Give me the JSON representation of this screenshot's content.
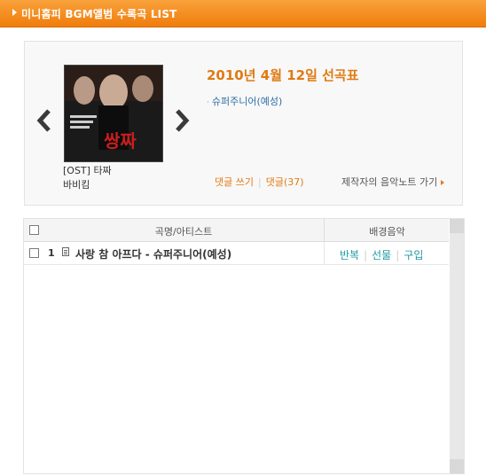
{
  "header": {
    "title": "미니홈피 BGM앨범 수록곡 LIST"
  },
  "featured": {
    "date": "2010년 4월 12일 선곡표",
    "song": "슈퍼주니어(예성)",
    "album": "[OST] 타짜",
    "artist": "바비킴",
    "cover_caption": "쌍짜"
  },
  "links": {
    "write_comment": "댓글 쓰기",
    "comments": "댓글(37)",
    "maker_note": "제작자의 음악노트 가기"
  },
  "table": {
    "columns": [
      "곡명/아티스트",
      "배경음악"
    ],
    "rows": [
      {
        "num": "1",
        "title": "사랑 참 아프다 - 슈퍼주니어(예성)",
        "actions": [
          "반복",
          "선물",
          "구입"
        ]
      }
    ]
  },
  "colors": {
    "accent": "#f07d0b",
    "date": "#e07a12",
    "link": "#2d6fa6",
    "action": "#1f9aa0"
  }
}
